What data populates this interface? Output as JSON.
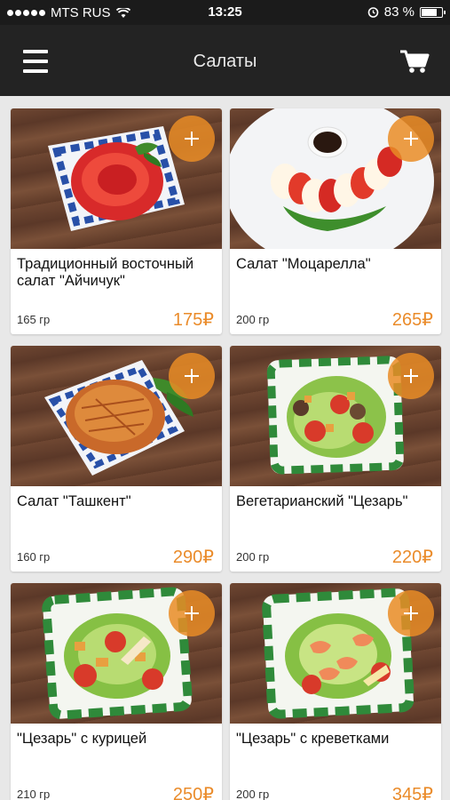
{
  "status_bar": {
    "carrier": "MTS RUS",
    "time": "13:25",
    "battery": "83 %",
    "battery_level": 0.83
  },
  "header": {
    "title": "Салаты",
    "menu_icon": "hamburger-menu-icon",
    "cart_icon": "shopping-cart-icon"
  },
  "accent_color": "#ea8b2a",
  "products": [
    {
      "name": "Традиционный восточный салат \"Айчичук\"",
      "weight": "165 гр",
      "price": "175₽",
      "image": "tomato-rose-salad"
    },
    {
      "name": "Салат \"Моцарелла\"",
      "weight": "200 гр",
      "price": "265₽",
      "image": "caprese-plate"
    },
    {
      "name": "Салат \"Ташкент\"",
      "weight": "160 гр",
      "price": "290₽",
      "image": "crispy-potato-salad"
    },
    {
      "name": "Вегетарианский \"Цезарь\"",
      "weight": "200 гр",
      "price": "220₽",
      "image": "vegetarian-caesar"
    },
    {
      "name": "\"Цезарь\" с курицей",
      "weight": "210 гр",
      "price": "250₽",
      "image": "chicken-caesar"
    },
    {
      "name": "\"Цезарь\" с креветками",
      "weight": "200 гр",
      "price": "345₽",
      "image": "shrimp-caesar"
    }
  ]
}
